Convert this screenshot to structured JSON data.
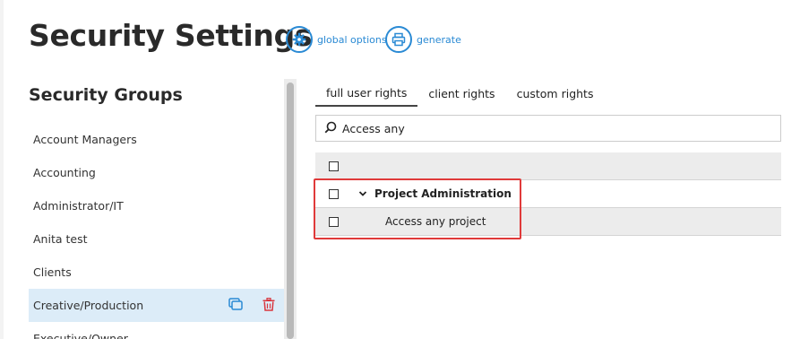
{
  "page": {
    "title": "Security Settings"
  },
  "header_actions": {
    "global_options": "global options",
    "generate": "generate"
  },
  "groups": {
    "title": "Security Groups",
    "items": [
      {
        "label": "Account Managers"
      },
      {
        "label": "Accounting"
      },
      {
        "label": "Administrator/IT"
      },
      {
        "label": "Anita test"
      },
      {
        "label": "Clients"
      },
      {
        "label": "Creative/Production"
      },
      {
        "label": "Executive/Owner"
      }
    ],
    "selected": "Creative/Production"
  },
  "tabs": [
    {
      "label": "full user rights",
      "active": true
    },
    {
      "label": "client rights",
      "active": false
    },
    {
      "label": "custom rights",
      "active": false
    }
  ],
  "search": {
    "value": "Access any"
  },
  "rights": {
    "group_row": {
      "label": "Project Administration",
      "expanded": true
    },
    "child_row": {
      "label": "Access any project"
    }
  },
  "colors": {
    "accent": "#2a8ad4",
    "selected_bg": "#dcecf8",
    "delete": "#d9363e",
    "highlight": "#e03a3a"
  },
  "icons": [
    "gear-icon",
    "printer-icon",
    "search-icon",
    "chevron-down-icon",
    "copy-icon",
    "trash-icon"
  ]
}
